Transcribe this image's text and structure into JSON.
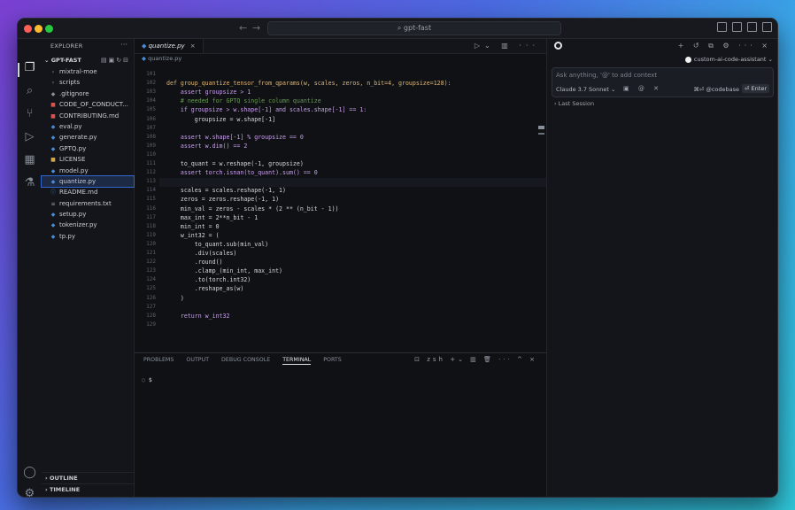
{
  "window": {
    "title": "gpt-fast"
  },
  "traffic_colors": [
    "#ff5f57",
    "#febc2e",
    "#28c840"
  ],
  "sidebar": {
    "title": "EXPLORER",
    "folder": "GPT-FAST",
    "items": [
      {
        "label": "mixtral-moe",
        "icon": "›",
        "color": "#9aa0a8"
      },
      {
        "label": "scripts",
        "icon": "›",
        "color": "#9aa0a8"
      },
      {
        "label": ".gitignore",
        "icon": "◆",
        "color": "#8a9099"
      },
      {
        "label": "CODE_OF_CONDUCT...",
        "icon": "■",
        "color": "#d9534f"
      },
      {
        "label": "CONTRIBUTING.md",
        "icon": "■",
        "color": "#d9534f"
      },
      {
        "label": "eval.py",
        "icon": "◆",
        "color": "#4b8bd4"
      },
      {
        "label": "generate.py",
        "icon": "◆",
        "color": "#4b8bd4"
      },
      {
        "label": "GPTQ.py",
        "icon": "◆",
        "color": "#4b8bd4"
      },
      {
        "label": "LICENSE",
        "icon": "■",
        "color": "#d4a84b"
      },
      {
        "label": "model.py",
        "icon": "◆",
        "color": "#4b8bd4"
      },
      {
        "label": "quantize.py",
        "icon": "◆",
        "color": "#4b8bd4"
      },
      {
        "label": "README.md",
        "icon": "ⓘ",
        "color": "#4b8bd4"
      },
      {
        "label": "requirements.txt",
        "icon": "≡",
        "color": "#9aa0a8"
      },
      {
        "label": "setup.py",
        "icon": "◆",
        "color": "#4b8bd4"
      },
      {
        "label": "tokenizer.py",
        "icon": "◆",
        "color": "#4b8bd4"
      },
      {
        "label": "tp.py",
        "icon": "◆",
        "color": "#4b8bd4"
      }
    ],
    "selected_index": 10,
    "outline": "OUTLINE",
    "timeline": "TIMELINE"
  },
  "editor": {
    "tab": "quantize.py",
    "breadcrumb": "quantize.py",
    "lines": [
      {
        "n": "101",
        "code": ""
      },
      {
        "n": "102",
        "code": "def group_quantize_tensor_from_qparams(w, scales, zeros, n_bit=4, groupsize=128):"
      },
      {
        "n": "103",
        "code": "    assert groupsize > 1"
      },
      {
        "n": "104",
        "code": "    # needed for GPTQ single column quantize"
      },
      {
        "n": "105",
        "code": "    if groupsize > w.shape[-1] and scales.shape[-1] == 1:"
      },
      {
        "n": "106",
        "code": "        groupsize = w.shape[-1]"
      },
      {
        "n": "107",
        "code": ""
      },
      {
        "n": "108",
        "code": "    assert w.shape[-1] % groupsize == 0"
      },
      {
        "n": "109",
        "code": "    assert w.dim() == 2"
      },
      {
        "n": "110",
        "code": ""
      },
      {
        "n": "111",
        "code": "    to_quant = w.reshape(-1, groupsize)"
      },
      {
        "n": "112",
        "code": "    assert torch.isnan(to_quant).sum() == 0"
      },
      {
        "n": "113",
        "code": ""
      },
      {
        "n": "114",
        "code": "    scales = scales.reshape(-1, 1)"
      },
      {
        "n": "115",
        "code": "    zeros = zeros.reshape(-1, 1)"
      },
      {
        "n": "116",
        "code": "    min_val = zeros - scales * (2 ** (n_bit - 1))"
      },
      {
        "n": "117",
        "code": "    max_int = 2**n_bit - 1"
      },
      {
        "n": "118",
        "code": "    min_int = 0"
      },
      {
        "n": "119",
        "code": "    w_int32 = ("
      },
      {
        "n": "120",
        "code": "        to_quant.sub(min_val)"
      },
      {
        "n": "121",
        "code": "        .div(scales)"
      },
      {
        "n": "122",
        "code": "        .round()"
      },
      {
        "n": "123",
        "code": "        .clamp_(min_int, max_int)"
      },
      {
        "n": "124",
        "code": "        .to(torch.int32)"
      },
      {
        "n": "125",
        "code": "        .reshape_as(w)"
      },
      {
        "n": "126",
        "code": "    )"
      },
      {
        "n": "127",
        "code": ""
      },
      {
        "n": "128",
        "code": "    return w_int32"
      },
      {
        "n": "129",
        "code": ""
      }
    ]
  },
  "panel": {
    "tabs": [
      "PROBLEMS",
      "OUTPUT",
      "DEBUG CONSOLE",
      "TERMINAL",
      "PORTS"
    ],
    "active_tab": "TERMINAL",
    "shell": "zsh",
    "prompt": "$"
  },
  "chat": {
    "assistant": "custom-ai-code-assistant",
    "placeholder": "Ask anything, '@' to add context",
    "model": "Claude 3.7 Sonnet",
    "codebase": "⌘⏎ @codebase",
    "enter": "⏎ Enter",
    "last_session": "Last Session"
  }
}
